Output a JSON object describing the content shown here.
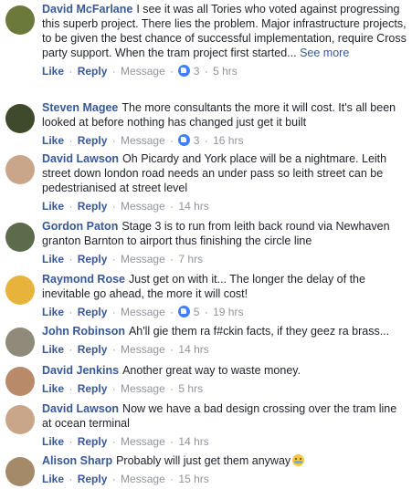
{
  "actions": {
    "like": "Like",
    "reply": "Reply",
    "message": "Message"
  },
  "comments": [
    {
      "author": "David McFarlane",
      "text": "I see it was all Tories who voted against progressing this superb project. There lies the problem. Major infrastructure projects, to be given the best chance of successful implementation, require Cross party support. When the tram project first started...",
      "more": "See more",
      "likes": "3",
      "time": "5 hrs",
      "avatar_color": "#6b7a3a"
    },
    {
      "author": "Steven Magee",
      "text": "The more consultants the more it will cost. It's all been looked at before nothing has changed just get it built",
      "likes": "3",
      "time": "16 hrs",
      "avatar_color": "#3f4a2a"
    },
    {
      "author": "David Lawson",
      "text": "Oh Picardy and York place will be a nightmare. Leith street down london road needs an under pass so leith street can be pedestrianised at street level",
      "likes": "",
      "time": "14 hrs",
      "avatar_color": "#c9a68a"
    },
    {
      "author": "Gordon Paton",
      "text": "Stage 3 is to run from leith back round via Newhaven granton Barnton to airport thus finishing the circle line",
      "likes": "",
      "time": "7 hrs",
      "avatar_color": "#5c6b4a"
    },
    {
      "author": "Raymond Rose",
      "text": "Just get on with it... The longer the delay of the inevitable go ahead, the more it will cost!",
      "likes": "5",
      "time": "19 hrs",
      "avatar_color": "#e8b33a"
    },
    {
      "author": "John Robinson",
      "text": "Ah'll gie them ra f#ckin facts, if they geez ra brass...",
      "likes": "",
      "time": "14 hrs",
      "avatar_color": "#8f8a7a"
    },
    {
      "author": "David Jenkins",
      "text": "Another great way to waste money.",
      "likes": "",
      "time": "5 hrs",
      "avatar_color": "#b98a6a"
    },
    {
      "author": "David Lawson",
      "text": "Now we have a bad design crossing over the tram line at ocean terminal",
      "likes": "",
      "time": "14 hrs",
      "avatar_color": "#c9a68a"
    },
    {
      "author": "Alison Sharp",
      "text": "Probably will just get them anyway",
      "emoji": "crying-face",
      "likes": "",
      "time": "15 hrs",
      "avatar_color": "#a58a6a"
    }
  ]
}
